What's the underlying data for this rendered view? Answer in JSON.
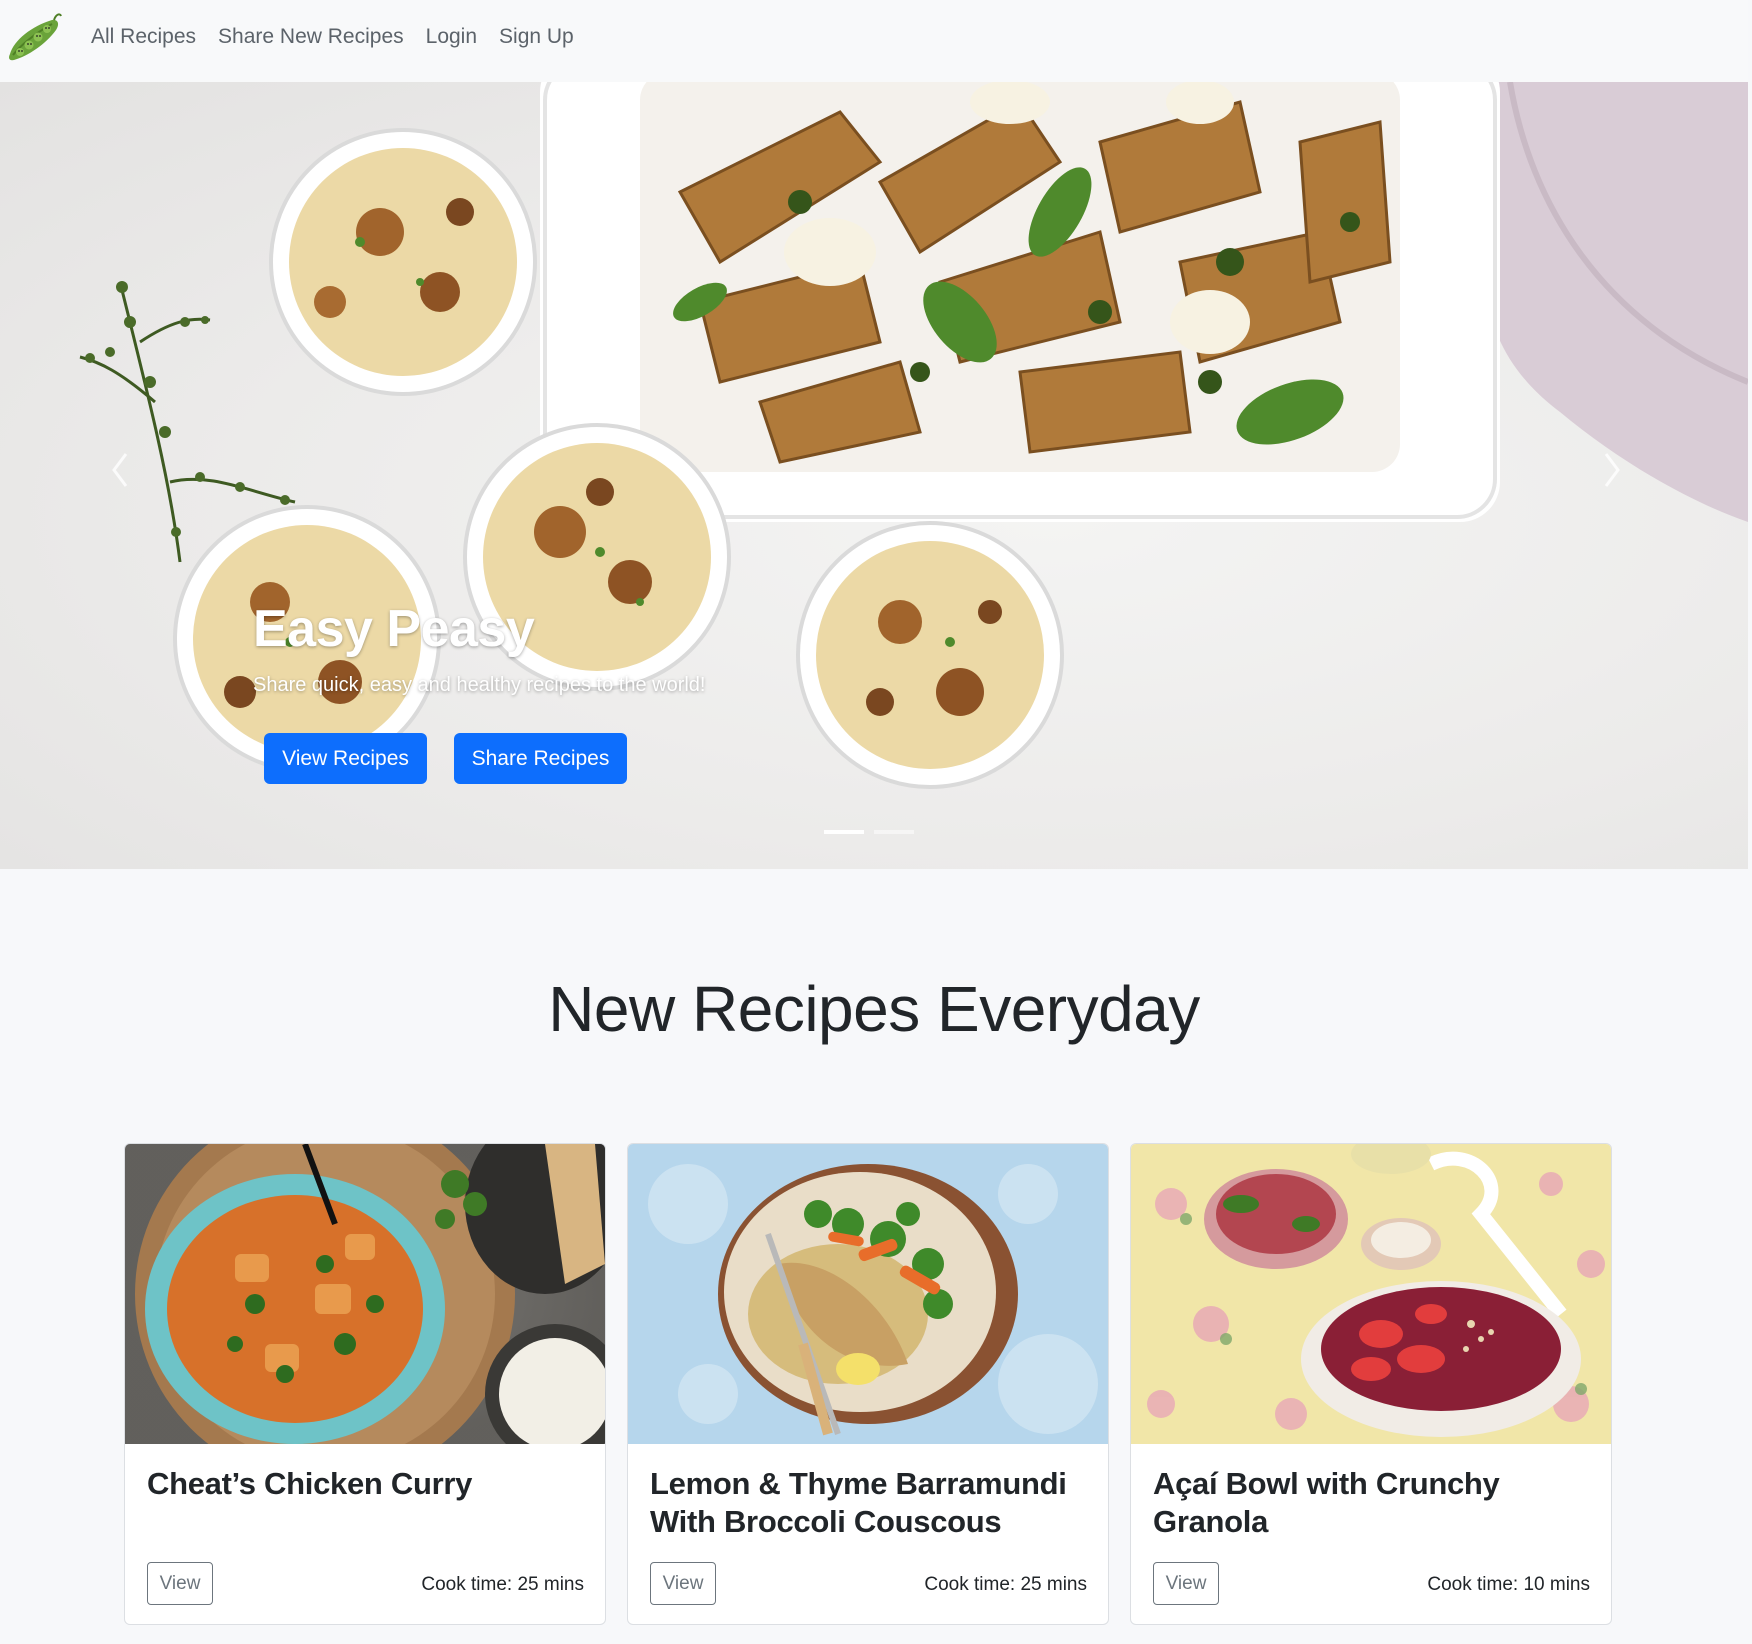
{
  "nav": {
    "logo_icon": "peapod-logo-icon",
    "links": [
      "All Recipes",
      "Share New Recipes",
      "Login",
      "Sign Up"
    ]
  },
  "hero": {
    "title": "Easy Peasy",
    "subtitle": "Share quick, easy and healthy recipes to the world!",
    "buttons": [
      "View Recipes",
      "Share Recipes"
    ],
    "slide_count": 2,
    "active_slide": 1
  },
  "section": {
    "heading": "New Recipes Everyday"
  },
  "cards": [
    {
      "title": "Cheat’s Chicken Curry",
      "button": "View",
      "cook_time": "Cook time: 25 mins"
    },
    {
      "title": "Lemon & Thyme Barramundi With Broccoli Couscous",
      "button": "View",
      "cook_time": "Cook time: 25 mins"
    },
    {
      "title": "Açaí Bowl with Crunchy Granola",
      "button": "View",
      "cook_time": "Cook time: 10 mins"
    }
  ],
  "colors": {
    "primary": "#0d6efd",
    "navbar_bg": "#f8f9fa",
    "page_bg": "#f7f8fa"
  }
}
